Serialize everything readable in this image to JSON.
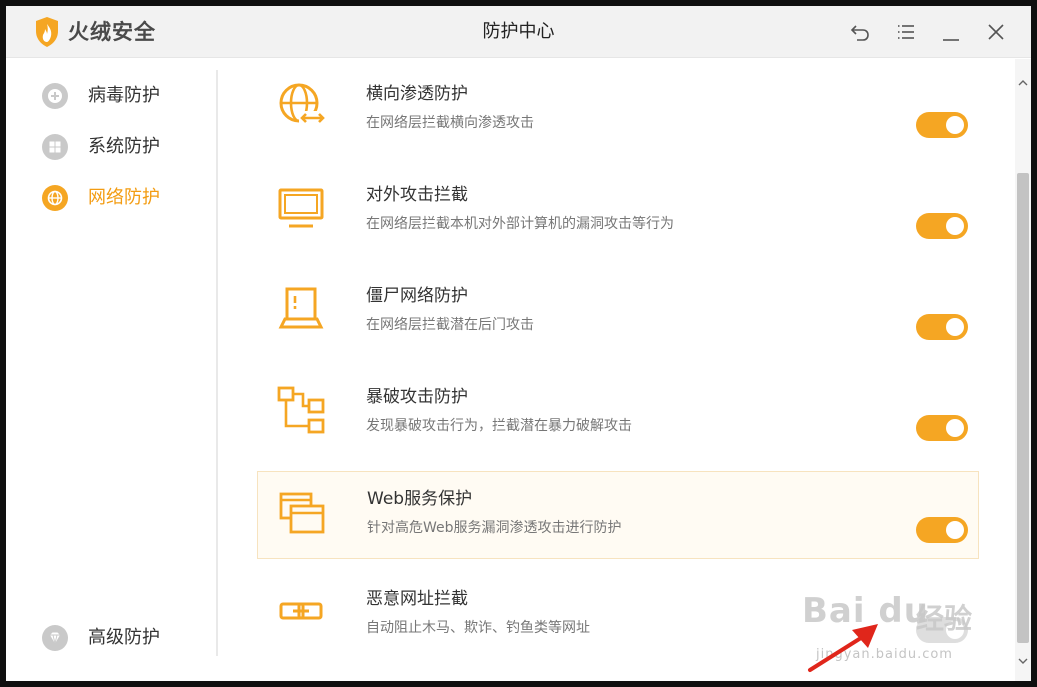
{
  "app": {
    "brand": "火绒安全",
    "window_title": "防护中心",
    "accent_color": "#f5a623"
  },
  "window_controls": [
    {
      "name": "back-icon"
    },
    {
      "name": "menu-icon"
    },
    {
      "name": "minimize-icon"
    },
    {
      "name": "close-icon"
    }
  ],
  "sidebar": {
    "items": [
      {
        "label": "病毒防护",
        "icon": "virus-protection-icon",
        "active": false
      },
      {
        "label": "系统防护",
        "icon": "windows-icon",
        "active": false
      },
      {
        "label": "网络防护",
        "icon": "globe-icon",
        "active": true
      }
    ],
    "bottom_item": {
      "label": "高级防护",
      "icon": "diamond-icon"
    }
  },
  "protections": [
    {
      "title": "横向渗透防护",
      "desc": "在网络层拦截横向渗透攻击",
      "icon": "globe-arrows-icon",
      "enabled": true
    },
    {
      "title": "对外攻击拦截",
      "desc": "在网络层拦截本机对外部计算机的漏洞攻击等行为",
      "icon": "monitor-icon",
      "enabled": true
    },
    {
      "title": "僵尸网络防护",
      "desc": "在网络层拦截潜在后门攻击",
      "icon": "laptop-alert-icon",
      "enabled": true
    },
    {
      "title": "暴破攻击防护",
      "desc": "发现暴破攻击行为，拦截潜在暴力破解攻击",
      "icon": "flow-nodes-icon",
      "enabled": true
    },
    {
      "title": "Web服务保护",
      "desc": "针对高危Web服务漏洞渗透攻击进行防护",
      "icon": "browser-windows-icon",
      "enabled": true
    },
    {
      "title": "恶意网址拦截",
      "desc": "自动阻止木马、欺诈、钓鱼类等网址",
      "icon": "link-icon",
      "enabled": true
    }
  ],
  "watermark": {
    "logo": "Bai du",
    "cn": "经验",
    "url": "jingyan.baidu.com"
  }
}
